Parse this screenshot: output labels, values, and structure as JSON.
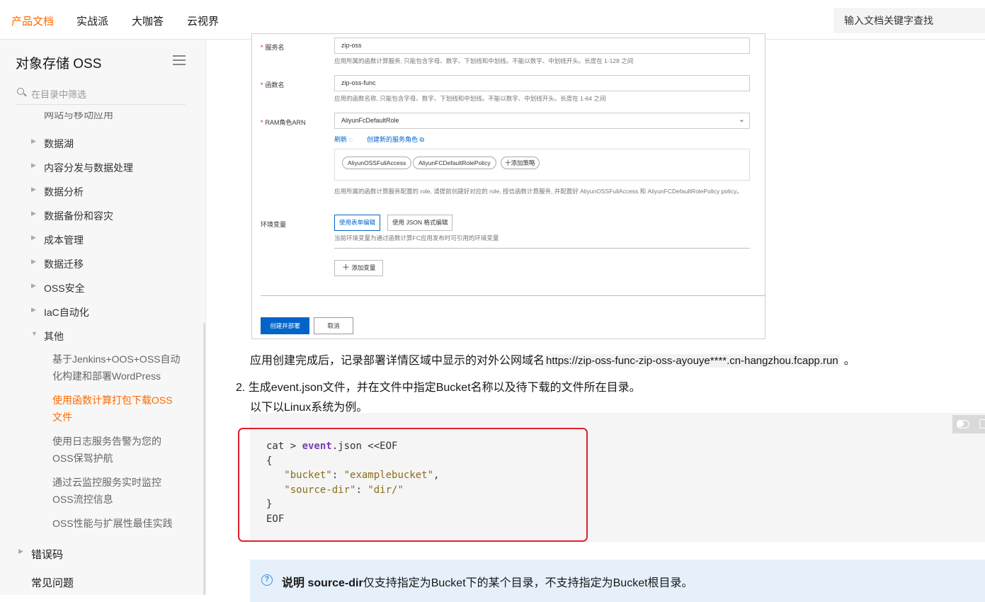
{
  "topnav": {
    "items": [
      "产品文档",
      "实战派",
      "大咖答",
      "云视界"
    ],
    "search_placeholder": "输入文档关键字查找"
  },
  "sidebar": {
    "title": "对象存储 OSS",
    "filter_placeholder": "在目录中筛选",
    "partial_item": "网站与移动应用",
    "items": [
      "数据湖",
      "内容分发与数据处理",
      "数据分析",
      "数据备份和容灾",
      "成本管理",
      "数据迁移",
      "OSS安全",
      "IaC自动化",
      "其他"
    ],
    "sub_items": [
      "基于Jenkins+OOS+OSS自动化构建和部署WordPress",
      "使用函数计算打包下载OSS文件",
      "使用日志服务告警为您的OSS保驾护航",
      "通过云监控服务实时监控OSS流控信息",
      "OSS性能与扩展性最佳实践"
    ],
    "bottom_items": [
      "错误码",
      "常见问题"
    ]
  },
  "form": {
    "service_label": "服务名",
    "service_value": "zip-oss",
    "service_hint": "应用所属的函数计算服务, 只能包含字母、数字、下划线和中划线。不能以数字、中划线开头。长度在 1-128 之间",
    "function_label": "函数名",
    "function_value": "zip-oss-func",
    "function_hint": "应用的函数名称, 只能包含字母、数字、下划线和中划线。不能以数字、中划线开头。长度在 1-64 之间",
    "ram_label": "RAM角色ARN",
    "ram_value": "AliyunFcDefaultRole",
    "refresh_link": "刷新",
    "create_role_link": "创建新的服务角色",
    "policies": [
      "AliyunOSSFullAccess",
      "AliyunFCDefaultRolePolicy"
    ],
    "add_policy": "十添加策略",
    "ram_hint": "应用所属的函数计算服务配置的 role, 请提前创建好对应的 role, 授信函数计算服务, 并配置好 AliyunOSSFullAccess 和 AliyunFCDefaultRolePolicy policy。",
    "env_label": "环境变量",
    "env_form_btn": "使用表单编辑",
    "env_json_btn": "使用 JSON 格式编辑",
    "env_hint": "当前环境变量为通过函数计算FC应用发布时可引用的环境变量",
    "add_var": "添加变量",
    "submit": "创建并部署",
    "cancel": "取消"
  },
  "article": {
    "after_create_prefix": "应用创建完成后，记录部署详情区域中显示的对外公网域名",
    "domain": "https://zip-oss-func-zip-oss-ayouye****.cn-hangzhou.fcapp.run",
    "after_create_suffix": "。",
    "step_number": "2.",
    "step_text": "生成event.json文件，并在文件中指定Bucket名称以及待下载的文件所在目录。",
    "example_text": "以下以Linux系统为例。"
  },
  "code": {
    "lines": [
      "cat > event.json <<EOF",
      "{",
      "   \"bucket\": \"examplebucket\",",
      "   \"source-dir\": \"dir/\"",
      "}",
      "EOF"
    ]
  },
  "note": {
    "label": "说明",
    "keyword": "source-dir",
    "text": "仅支持指定为Bucket下的某个目录，不支持指定为Bucket根目录。"
  },
  "colors": {
    "accent": "#ff6a00",
    "link": "#0064c8",
    "highlight_box": "#e0202f",
    "note_bg": "#e6f0fb"
  }
}
